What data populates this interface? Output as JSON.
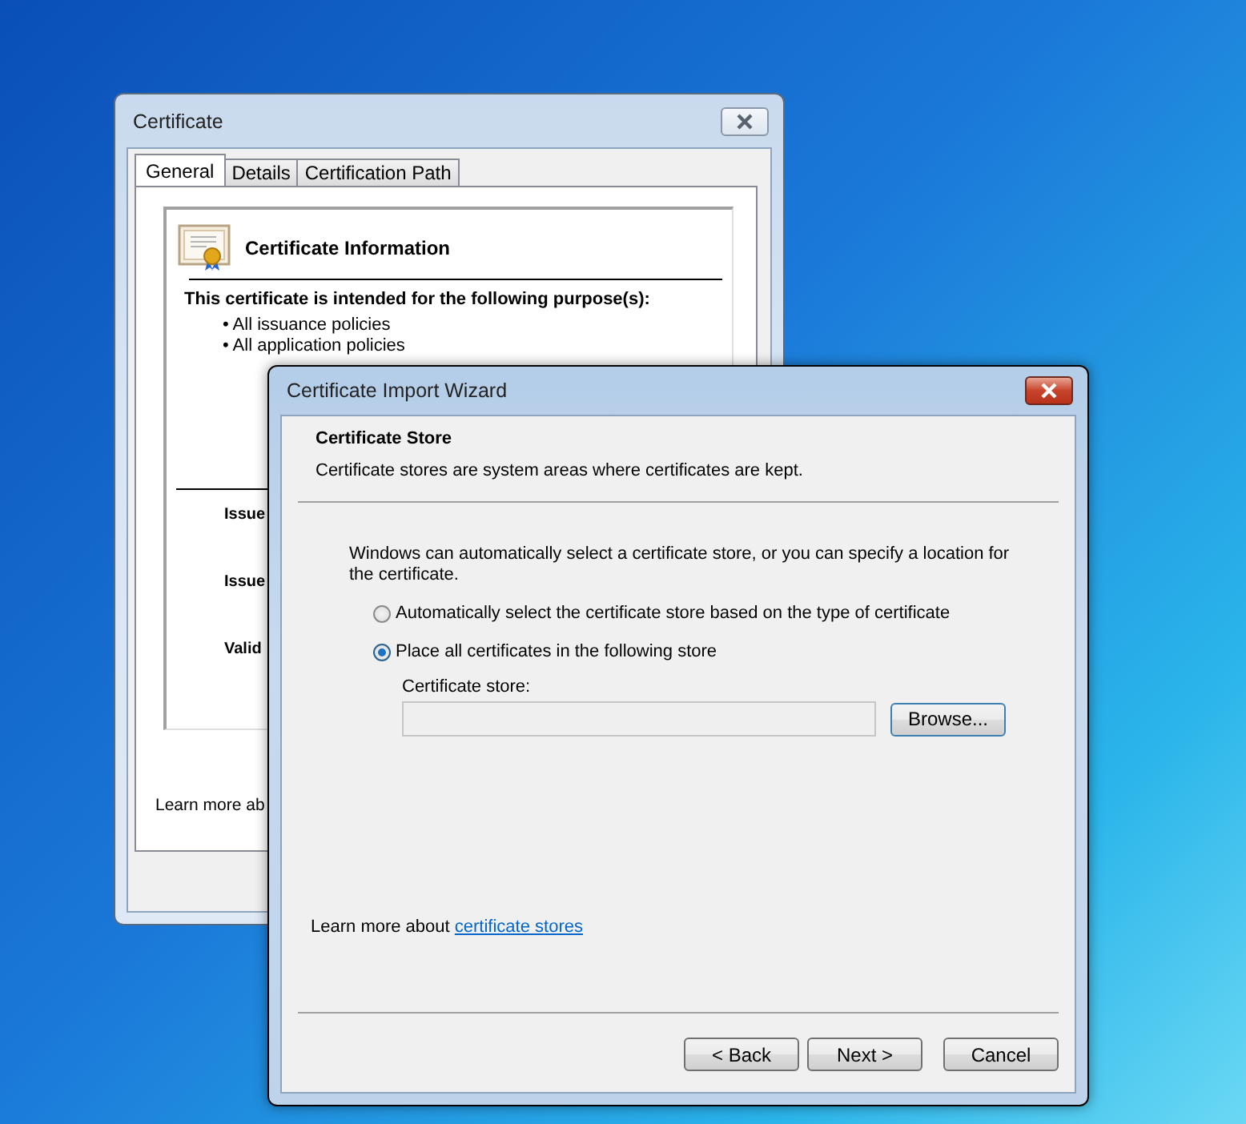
{
  "certificate_window": {
    "title": "Certificate",
    "tabs": [
      {
        "label": "General",
        "selected": true
      },
      {
        "label": "Details",
        "selected": false
      },
      {
        "label": "Certification Path",
        "selected": false
      }
    ],
    "heading": "Certificate Information",
    "purpose_title": "This certificate is intended for the following purpose(s):",
    "purposes": [
      "• All issuance policies",
      "• All application policies"
    ],
    "fields": [
      "Issue",
      "Issue",
      "Valid"
    ],
    "learn_more": "Learn more ab"
  },
  "wizard": {
    "title": "Certificate Import Wizard",
    "header_title": "Certificate Store",
    "header_subtitle": "Certificate stores are system areas where certificates are kept.",
    "intro": "Windows can automatically select a certificate store, or you can specify a location for the certificate.",
    "options": [
      {
        "label": "Automatically select the certificate store based on the type of certificate",
        "selected": false
      },
      {
        "label": "Place all certificates in the following store",
        "selected": true
      }
    ],
    "store_label": "Certificate store:",
    "browse_button": "Browse...",
    "learn_more": {
      "text": "Learn more about",
      "link": "certificate stores"
    },
    "buttons": [
      "< Back",
      "Next >",
      "Cancel"
    ]
  }
}
